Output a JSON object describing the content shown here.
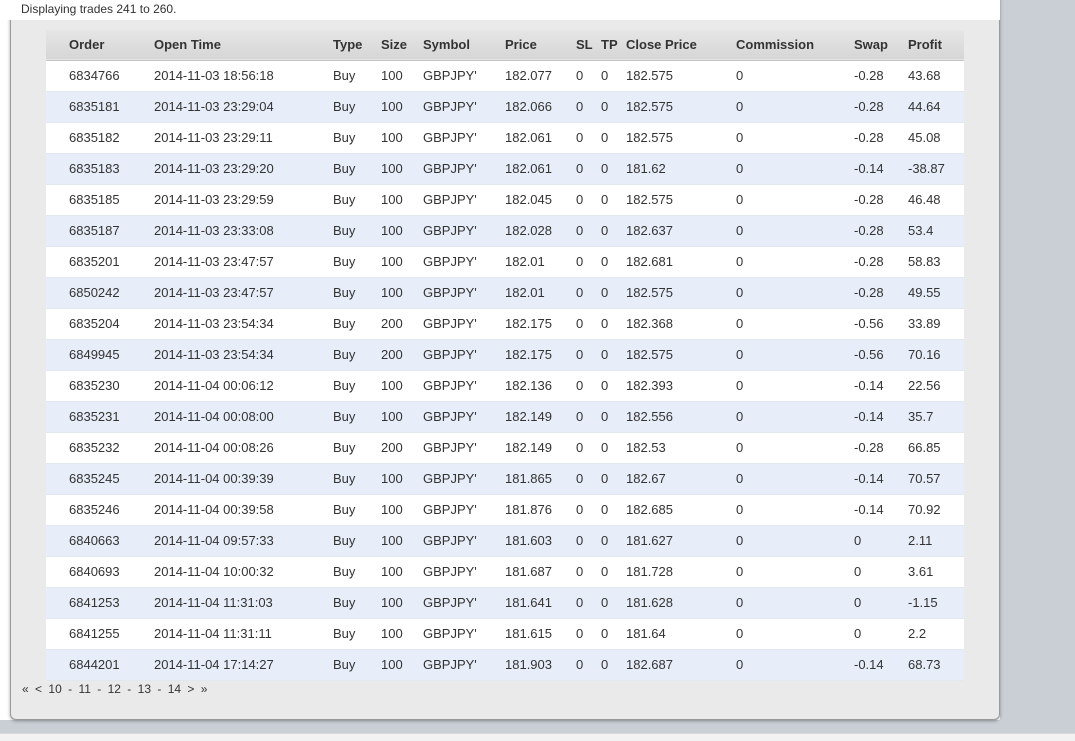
{
  "caption": "Displaying trades 241 to 260.",
  "columns": [
    "Order",
    "Open Time",
    "Type",
    "Size",
    "Symbol",
    "Price",
    "SL",
    "TP",
    "Close Price",
    "Commission",
    "Swap",
    "Profit"
  ],
  "rows": [
    [
      "6834766",
      "2014-11-03 18:56:18",
      "Buy",
      "100",
      "GBPJPY'",
      "182.077",
      "0",
      "0",
      "182.575",
      "0",
      "-0.28",
      "43.68"
    ],
    [
      "6835181",
      "2014-11-03 23:29:04",
      "Buy",
      "100",
      "GBPJPY'",
      "182.066",
      "0",
      "0",
      "182.575",
      "0",
      "-0.28",
      "44.64"
    ],
    [
      "6835182",
      "2014-11-03 23:29:11",
      "Buy",
      "100",
      "GBPJPY'",
      "182.061",
      "0",
      "0",
      "182.575",
      "0",
      "-0.28",
      "45.08"
    ],
    [
      "6835183",
      "2014-11-03 23:29:20",
      "Buy",
      "100",
      "GBPJPY'",
      "182.061",
      "0",
      "0",
      "181.62",
      "0",
      "-0.14",
      "-38.87"
    ],
    [
      "6835185",
      "2014-11-03 23:29:59",
      "Buy",
      "100",
      "GBPJPY'",
      "182.045",
      "0",
      "0",
      "182.575",
      "0",
      "-0.28",
      "46.48"
    ],
    [
      "6835187",
      "2014-11-03 23:33:08",
      "Buy",
      "100",
      "GBPJPY'",
      "182.028",
      "0",
      "0",
      "182.637",
      "0",
      "-0.28",
      "53.4"
    ],
    [
      "6835201",
      "2014-11-03 23:47:57",
      "Buy",
      "100",
      "GBPJPY'",
      "182.01",
      "0",
      "0",
      "182.681",
      "0",
      "-0.28",
      "58.83"
    ],
    [
      "6850242",
      "2014-11-03 23:47:57",
      "Buy",
      "100",
      "GBPJPY'",
      "182.01",
      "0",
      "0",
      "182.575",
      "0",
      "-0.28",
      "49.55"
    ],
    [
      "6835204",
      "2014-11-03 23:54:34",
      "Buy",
      "200",
      "GBPJPY'",
      "182.175",
      "0",
      "0",
      "182.368",
      "0",
      "-0.56",
      "33.89"
    ],
    [
      "6849945",
      "2014-11-03 23:54:34",
      "Buy",
      "200",
      "GBPJPY'",
      "182.175",
      "0",
      "0",
      "182.575",
      "0",
      "-0.56",
      "70.16"
    ],
    [
      "6835230",
      "2014-11-04 00:06:12",
      "Buy",
      "100",
      "GBPJPY'",
      "182.136",
      "0",
      "0",
      "182.393",
      "0",
      "-0.14",
      "22.56"
    ],
    [
      "6835231",
      "2014-11-04 00:08:00",
      "Buy",
      "100",
      "GBPJPY'",
      "182.149",
      "0",
      "0",
      "182.556",
      "0",
      "-0.14",
      "35.7"
    ],
    [
      "6835232",
      "2014-11-04 00:08:26",
      "Buy",
      "200",
      "GBPJPY'",
      "182.149",
      "0",
      "0",
      "182.53",
      "0",
      "-0.28",
      "66.85"
    ],
    [
      "6835245",
      "2014-11-04 00:39:39",
      "Buy",
      "100",
      "GBPJPY'",
      "181.865",
      "0",
      "0",
      "182.67",
      "0",
      "-0.14",
      "70.57"
    ],
    [
      "6835246",
      "2014-11-04 00:39:58",
      "Buy",
      "100",
      "GBPJPY'",
      "181.876",
      "0",
      "0",
      "182.685",
      "0",
      "-0.14",
      "70.92"
    ],
    [
      "6840663",
      "2014-11-04 09:57:33",
      "Buy",
      "100",
      "GBPJPY'",
      "181.603",
      "0",
      "0",
      "181.627",
      "0",
      "0",
      "2.11"
    ],
    [
      "6840693",
      "2014-11-04 10:00:32",
      "Buy",
      "100",
      "GBPJPY'",
      "181.687",
      "0",
      "0",
      "181.728",
      "0",
      "0",
      "3.61"
    ],
    [
      "6841253",
      "2014-11-04 11:31:03",
      "Buy",
      "100",
      "GBPJPY'",
      "181.641",
      "0",
      "0",
      "181.628",
      "0",
      "0",
      "-1.15"
    ],
    [
      "6841255",
      "2014-11-04 11:31:11",
      "Buy",
      "100",
      "GBPJPY'",
      "181.615",
      "0",
      "0",
      "181.64",
      "0",
      "0",
      "2.2"
    ],
    [
      "6844201",
      "2014-11-04 17:14:27",
      "Buy",
      "100",
      "GBPJPY'",
      "181.903",
      "0",
      "0",
      "182.687",
      "0",
      "-0.14",
      "68.73"
    ]
  ],
  "pager": {
    "first": "«",
    "prev": "<",
    "pages": [
      "10",
      "11",
      "12",
      "13",
      "14"
    ],
    "separator": "-",
    "next": ">",
    "last": "»"
  }
}
